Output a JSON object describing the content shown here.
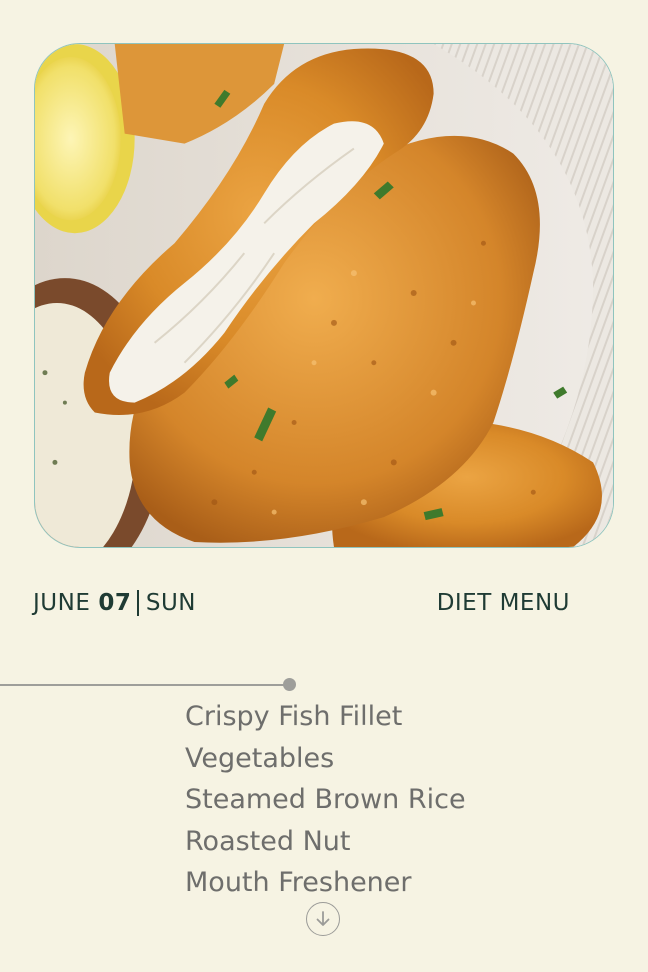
{
  "photo": {
    "subject": "crispy-fish-fillet-photo"
  },
  "header": {
    "month": "JUNE",
    "day": "07",
    "weekday": "SUN",
    "menu_title": "DIET MENU"
  },
  "menu": {
    "items": [
      "Crispy Fish Fillet",
      "Vegetables",
      "Steamed Brown Rice",
      "Roasted Nut",
      "Mouth Freshener"
    ]
  },
  "icons": {
    "scroll_down": "arrow-down-circle-icon"
  },
  "colors": {
    "background": "#f6f3e3",
    "accent_text": "#1f3b34",
    "list_text": "#6e6e6c",
    "card_border": "#8fc4be"
  }
}
